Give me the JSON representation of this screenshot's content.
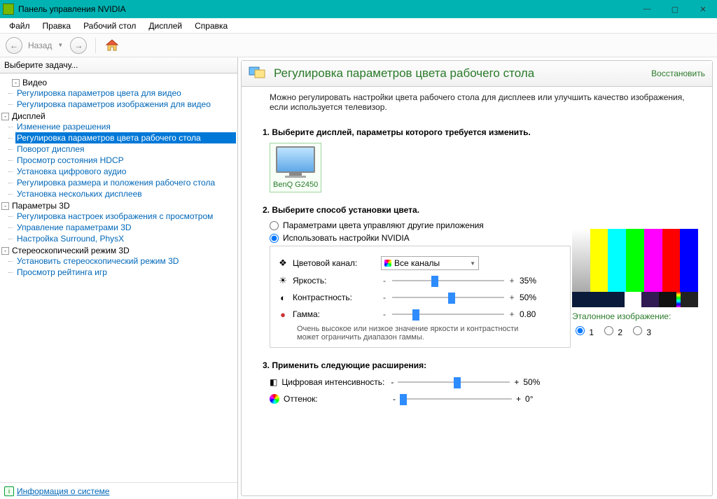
{
  "window": {
    "title": "Панель управления NVIDIA"
  },
  "menu": {
    "file": "Файл",
    "edit": "Правка",
    "desktop": "Рабочий стол",
    "display": "Дисплей",
    "help": "Справка"
  },
  "toolbar": {
    "back": "Назад"
  },
  "sidebar": {
    "task_header": "Выберите задачу...",
    "groups": [
      {
        "label": "Видео",
        "items": [
          "Регулировка параметров цвета для видео",
          "Регулировка параметров изображения для видео"
        ]
      },
      {
        "label": "Дисплей",
        "items": [
          "Изменение разрешения",
          "Регулировка параметров цвета рабочего стола",
          "Поворот дисплея",
          "Просмотр состояния HDCP",
          "Установка цифрового аудио",
          "Регулировка размера и положения рабочего стола",
          "Установка нескольких дисплеев"
        ]
      },
      {
        "label": "Параметры 3D",
        "items": [
          "Регулировка настроек изображения с просмотром",
          "Управление параметрами 3D",
          "Настройка Surround, PhysX"
        ]
      },
      {
        "label": "Стереоскопический режим 3D",
        "items": [
          "Установить стереоскопический режим 3D",
          "Просмотр рейтинга игр"
        ]
      }
    ],
    "selected": "Регулировка параметров цвета рабочего стола",
    "system_info": "Информация о системе"
  },
  "page": {
    "title": "Регулировка параметров цвета рабочего стола",
    "restore": "Восстановить",
    "description": "Можно регулировать настройки цвета рабочего стола для дисплеев или улучшить качество изображения, если используется телевизор.",
    "step1": "1. Выберите дисплей, параметры которого требуется изменить.",
    "monitor": "BenQ G2450",
    "step2": "2. Выберите способ установки цвета.",
    "radio_other": "Параметрами цвета управляют другие приложения",
    "radio_nvidia": "Использовать настройки NVIDIA",
    "channel_label": "Цветовой канал:",
    "channel_value": "Все каналы",
    "brightness_label": "Яркость:",
    "brightness_value": "35%",
    "contrast_label": "Контрастность:",
    "contrast_value": "50%",
    "gamma_label": "Гамма:",
    "gamma_value": "0.80",
    "note": "Очень высокое или низкое значение яркости и контрастности может ограничить диапазон гаммы.",
    "step3": "3. Применить следующие расширения:",
    "vibrance_label": "Цифровая интенсивность:",
    "vibrance_value": "50%",
    "hue_label": "Оттенок:",
    "hue_value": "0°",
    "preview_label": "Эталонное изображение:",
    "ref_opts": [
      "1",
      "2",
      "3"
    ]
  }
}
